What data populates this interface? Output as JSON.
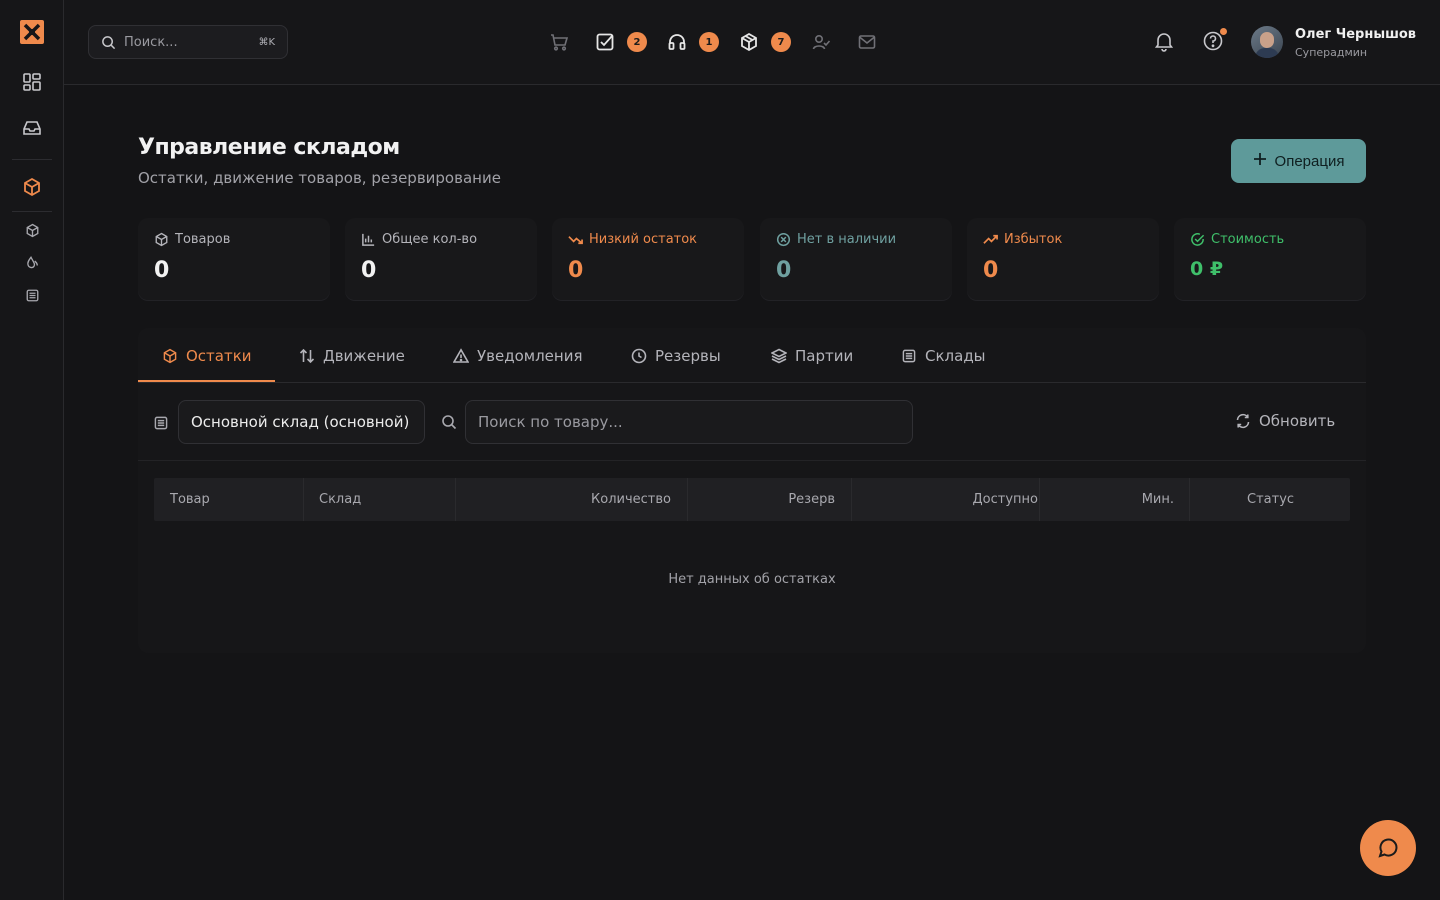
{
  "colors": {
    "accent": "#ef8a4c",
    "teal": "#5e9a9a",
    "success": "#3fbf6a",
    "background": "#141416"
  },
  "sidebar": {
    "items": [
      "logo-icon",
      "dashboard-icon",
      "inbox-icon",
      "box-icon",
      "package-icon",
      "drop-icon",
      "warehouse-icon"
    ]
  },
  "topbar": {
    "search_placeholder": "Поиск...",
    "search_shortcut": "⌘K",
    "badges": {
      "tasks": "2",
      "support": "1",
      "packages": "7"
    },
    "user": {
      "name": "Олег Чернышов",
      "role": "Суперадмин"
    }
  },
  "page": {
    "title": "Управление складом",
    "subtitle": "Остатки, движение товаров, резервирование",
    "operation_button": "Операция"
  },
  "stats": [
    {
      "label": "Товаров",
      "value": "0"
    },
    {
      "label": "Общее кол-во",
      "value": "0"
    },
    {
      "label": "Низкий остаток",
      "value": "0"
    },
    {
      "label": "Нет в наличии",
      "value": "0"
    },
    {
      "label": "Избыток",
      "value": "0"
    },
    {
      "label": "Стоимость",
      "value": "0 ₽"
    }
  ],
  "tabs": [
    "Остатки",
    "Движение",
    "Уведомления",
    "Резервы",
    "Партии",
    "Склады"
  ],
  "filters": {
    "warehouse": "Основной склад (основной)",
    "search_placeholder": "Поиск по товару...",
    "refresh": "Обновить"
  },
  "table": {
    "columns": [
      "Товар",
      "Склад",
      "Количество",
      "Резерв",
      "Доступно",
      "Мин.",
      "Статус"
    ],
    "empty": "Нет данных об остатках"
  }
}
